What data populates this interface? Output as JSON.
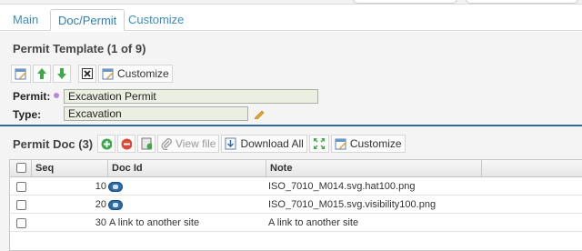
{
  "tabs": [
    {
      "label": "Main"
    },
    {
      "label": "Doc/Permit"
    },
    {
      "label": "Customize"
    }
  ],
  "permit_template": {
    "title": "Permit Template (1 of 9)",
    "toolbar": {
      "customize_label": "Customize"
    },
    "fields": {
      "permit_label": "Permit:",
      "permit_value": "Excavation Permit",
      "type_label": "Type:",
      "type_value": "Excavation"
    }
  },
  "permit_doc": {
    "title": "Permit Doc (3)",
    "toolbar": {
      "view_file_label": "View file",
      "download_all_label": "Download All",
      "customize_label": "Customize"
    },
    "columns": [
      "Seq",
      "Doc Id",
      "Note"
    ],
    "rows": [
      {
        "seq": "10",
        "doc_id": "",
        "doc_icon": "image-icon",
        "note": "ISO_7010_M014.svg.hat100.png"
      },
      {
        "seq": "20",
        "doc_id": "",
        "doc_icon": "image-icon",
        "note": "ISO_7010_M015.svg.visibility100.png"
      },
      {
        "seq": "30",
        "doc_id": "A link to another site",
        "doc_icon": "",
        "note": "A link to another site"
      }
    ]
  },
  "colors": {
    "tab_text": "#3a8ec0",
    "divider": "#2c66a6",
    "input_bg": "#ebefe1",
    "required_dot": "#b48ad6"
  }
}
